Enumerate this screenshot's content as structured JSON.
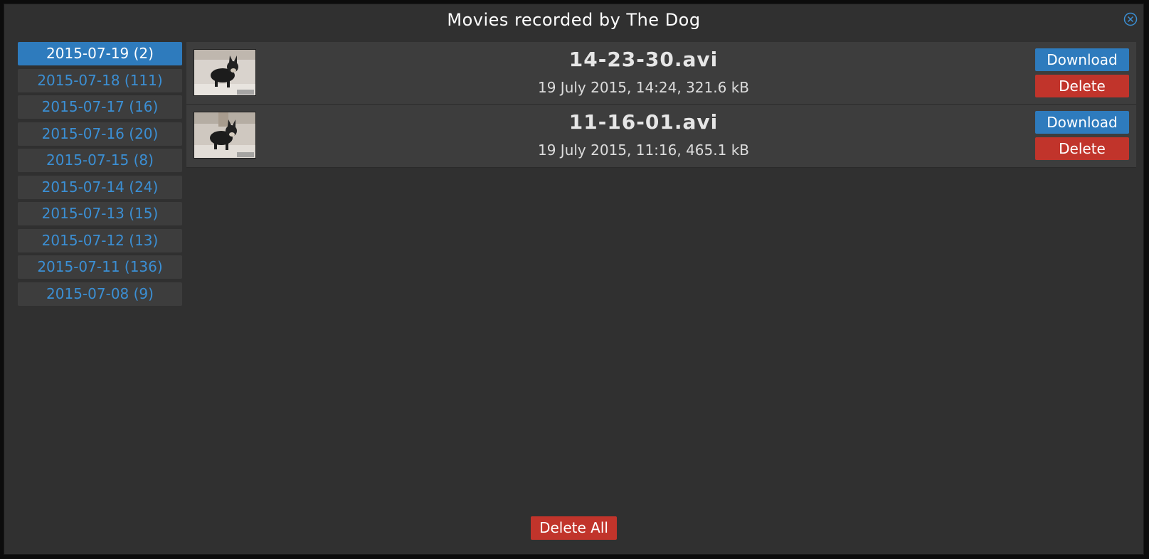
{
  "dialog": {
    "title": "Movies recorded by The Dog",
    "close_icon": "close-circle-icon"
  },
  "dates": [
    {
      "label": "2015-07-19 (2)",
      "active": true
    },
    {
      "label": "2015-07-18 (111)",
      "active": false
    },
    {
      "label": "2015-07-17 (16)",
      "active": false
    },
    {
      "label": "2015-07-16 (20)",
      "active": false
    },
    {
      "label": "2015-07-15 (8)",
      "active": false
    },
    {
      "label": "2015-07-14 (24)",
      "active": false
    },
    {
      "label": "2015-07-13 (15)",
      "active": false
    },
    {
      "label": "2015-07-12 (13)",
      "active": false
    },
    {
      "label": "2015-07-11 (136)",
      "active": false
    },
    {
      "label": "2015-07-08 (9)",
      "active": false
    }
  ],
  "movies": [
    {
      "name": "14-23-30.avi",
      "info": "19 July 2015, 14:24, 321.6 kB",
      "download_label": "Download",
      "delete_label": "Delete"
    },
    {
      "name": "11-16-01.avi",
      "info": "19 July 2015, 11:16, 465.1 kB",
      "download_label": "Download",
      "delete_label": "Delete"
    }
  ],
  "footer": {
    "delete_all_label": "Delete All"
  },
  "colors": {
    "background": "#303030",
    "accent_blue": "#2e7bbd",
    "link_blue": "#3b8fd4",
    "danger_red": "#c1342b"
  }
}
